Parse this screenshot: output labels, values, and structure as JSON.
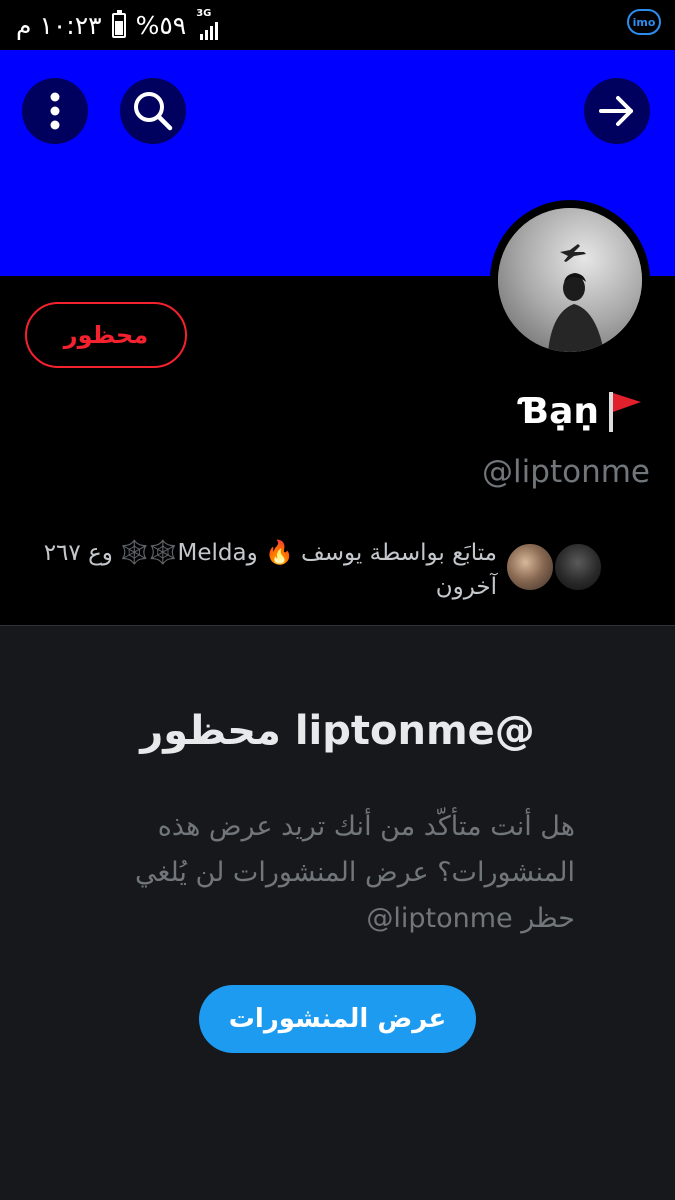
{
  "status_bar": {
    "time": "١٠:٢٣ م",
    "battery": "%٥٩",
    "network": "3G",
    "app_icon_label": "imo"
  },
  "icons": {
    "more": "more-vertical-icon",
    "search": "search-icon",
    "forward": "arrow-right-icon",
    "flag": "red-flag-icon"
  },
  "profile": {
    "blocked_label": "محظور",
    "display_name": "Ɓạṇ",
    "handle": "@liptonme",
    "followers_text": "متابَع بواسطة يوسف 🔥 وMelda🕸️🕸️ وع ٢٦٧ آخرون"
  },
  "blocked_panel": {
    "title": "@liptonme محظور",
    "description": "هل أنت متأكّد من أنك تريد عرض هذه المنشورات؟ عرض المنشورات لن يُلغي حظر liptonme@",
    "view_posts_button": "عرض المنشورات"
  },
  "colors": {
    "banner": "#0000ff",
    "blocked_red": "#f4212e",
    "primary_blue": "#1d9bf0",
    "panel_bg": "#16181c"
  }
}
